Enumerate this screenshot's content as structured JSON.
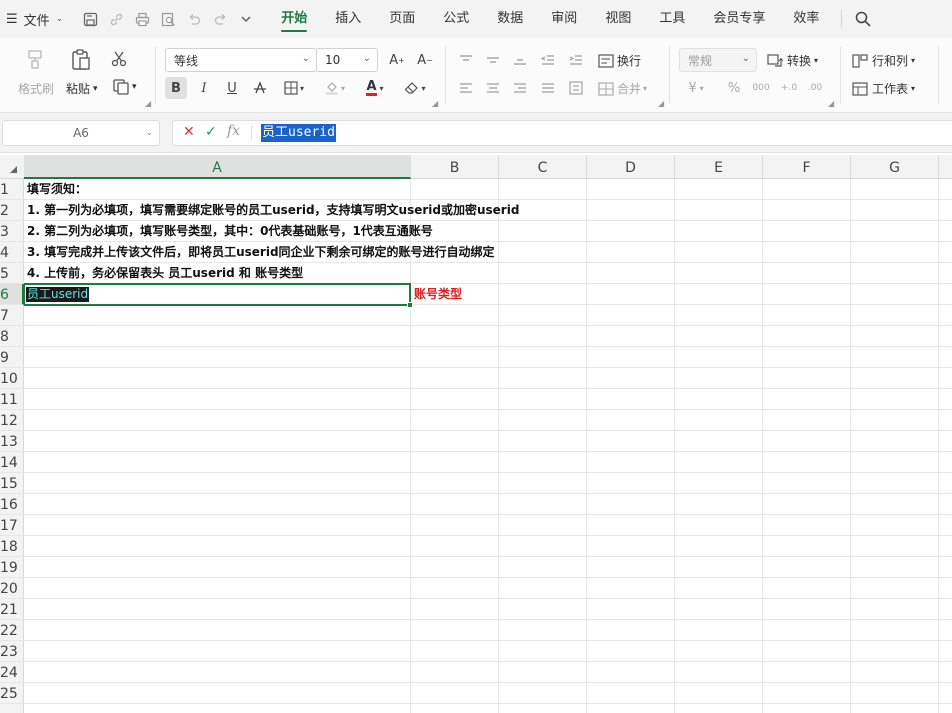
{
  "menubar": {
    "file_label": "文件",
    "tabs": [
      {
        "label": "开始",
        "active": true
      },
      {
        "label": "插入",
        "active": false
      },
      {
        "label": "页面",
        "active": false
      },
      {
        "label": "公式",
        "active": false
      },
      {
        "label": "数据",
        "active": false
      },
      {
        "label": "审阅",
        "active": false
      },
      {
        "label": "视图",
        "active": false
      },
      {
        "label": "工具",
        "active": false
      },
      {
        "label": "会员专享",
        "active": false
      },
      {
        "label": "效率",
        "active": false
      }
    ]
  },
  "ribbon": {
    "format_painter": "格式刷",
    "paste": "粘贴",
    "font_name": "等线",
    "font_size": "10",
    "wrap_text": "换行",
    "number_format": "常规",
    "convert": "转换",
    "merge": "合并",
    "rows_cols": "行和列",
    "worksheet": "工作表",
    "bold": "B",
    "italic": "I",
    "underline": "U",
    "font_color_letter": "A"
  },
  "formula_bar": {
    "cell_ref": "A6",
    "content": "员工userid"
  },
  "columns": [
    "A",
    "B",
    "C",
    "D",
    "E",
    "F",
    "G"
  ],
  "rows": [
    "1",
    "2",
    "3",
    "4",
    "5",
    "6",
    "7",
    "8",
    "9",
    "10",
    "11",
    "12",
    "13",
    "14",
    "15",
    "16",
    "17",
    "18",
    "19",
    "20",
    "21",
    "22",
    "23",
    "24",
    "25"
  ],
  "cells": {
    "A1": "填写须知：",
    "A2": "1. 第一列为必填项，填写需要绑定账号的员工userid，支持填写明文userid或加密userid",
    "A3": "2. 第二列为必填项，填写账号类型，其中：0代表基础账号，1代表互通账号",
    "A4": "3. 填写完成并上传该文件后，即将员工userid同企业下剩余可绑定的账号进行自动绑定",
    "A5": "4. 上传前，务必保留表头 员工userid 和 账号类型",
    "A6": "员工userid",
    "B6": "账号类型"
  },
  "colors": {
    "accent": "#1e7a42",
    "selection": "#1a63c9",
    "header_red": "#e02020"
  }
}
